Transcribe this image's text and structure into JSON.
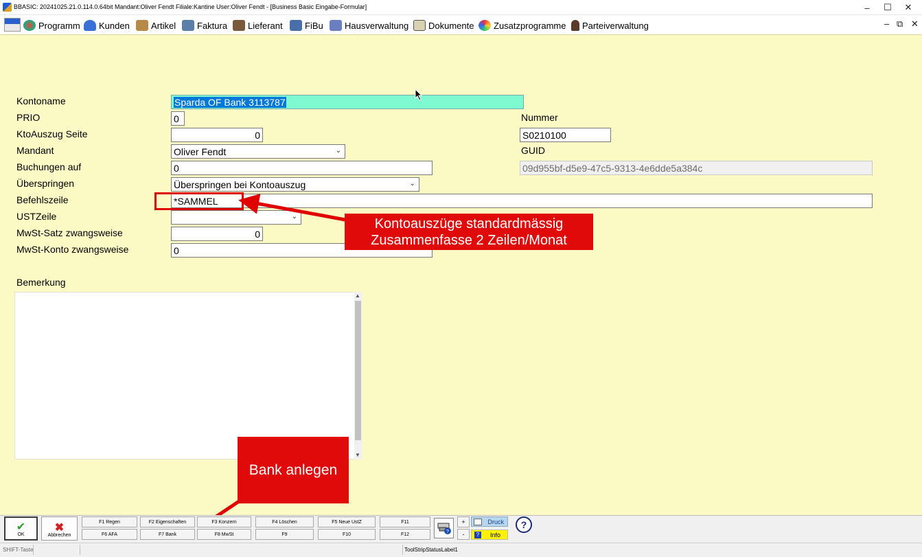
{
  "window": {
    "title": "BBASIC: 20241025.21.0.114.0.64bit Mandant:Oliver Fendt Filiale:Kantine User:Oliver Fendt - [Business Basic Eingabe-Formular]",
    "minimize": "–",
    "maximize": "☐",
    "close": "✕"
  },
  "menu": {
    "items": [
      "Programm",
      "Kunden",
      "Artikel",
      "Faktura",
      "Lieferant",
      "FiBu",
      "Hausverwaltung",
      "Dokumente",
      "Zusatzprogramme",
      "Parteiverwaltung"
    ],
    "mdi_minimize": "‒",
    "mdi_restore": "⧉",
    "mdi_close": "✕"
  },
  "form": {
    "labels": {
      "kontoname": "Kontoname",
      "prio": "PRIO",
      "ktoauszug": "KtoAuszug Seite",
      "mandant": "Mandant",
      "buchungen": "Buchungen auf",
      "ueberspringen": "Überspringen",
      "befehlszeile": "Befehlszeile",
      "ustzeile": "USTZeile",
      "mwst_satz": "MwSt-Satz zwangsweise",
      "mwst_konto": "MwSt-Konto zwangsweise",
      "nummer": "Nummer",
      "guid": "GUID",
      "bemerkung": "Bemerkung"
    },
    "values": {
      "kontoname": "Sparda OF Bank 3113787",
      "prio": "0",
      "ktoauszug": "0",
      "mandant": "Oliver Fendt",
      "buchungen": "0",
      "ueberspringen": "Überspringen bei Kontoauszug",
      "befehlszeile": "*SAMMEL",
      "ustzeile": "",
      "mwst_satz": "0",
      "mwst_konto": "0",
      "nummer": "S0210100",
      "guid": "09d955bf-d5e9-47c5-9313-4e6dde5a384c",
      "bemerkung": ""
    }
  },
  "annotations": {
    "callout1_line1": "Kontoauszüge standardmässig",
    "callout1_line2": "Zusammenfasse 2 Zeilen/Monat",
    "callout2": "Bank anlegen"
  },
  "toolbar": {
    "ok": "OK",
    "abbrechen": "Abbrechen",
    "fkeys_top": [
      "F1 Regen",
      "F2 Eigenschaften",
      "F3 Konzern",
      "F4 Löschen",
      "F5 Neue UstZ",
      "F11"
    ],
    "fkeys_bottom": [
      "F6 AFA",
      "F7 Bank",
      "F8 MwSt",
      "F9",
      "F10",
      "F12"
    ],
    "plus": "+",
    "minus": "-",
    "druck": "Druck",
    "info": "Info"
  },
  "status": {
    "shift": "SHIFT-Taste",
    "label1": "ToolStripStatusLabel1"
  },
  "colors": {
    "form_bg": "#fbf9c4",
    "kontoname_bg": "#7ff9d0",
    "annotation_red": "#e00a0a",
    "selection_blue": "#0078d7"
  }
}
